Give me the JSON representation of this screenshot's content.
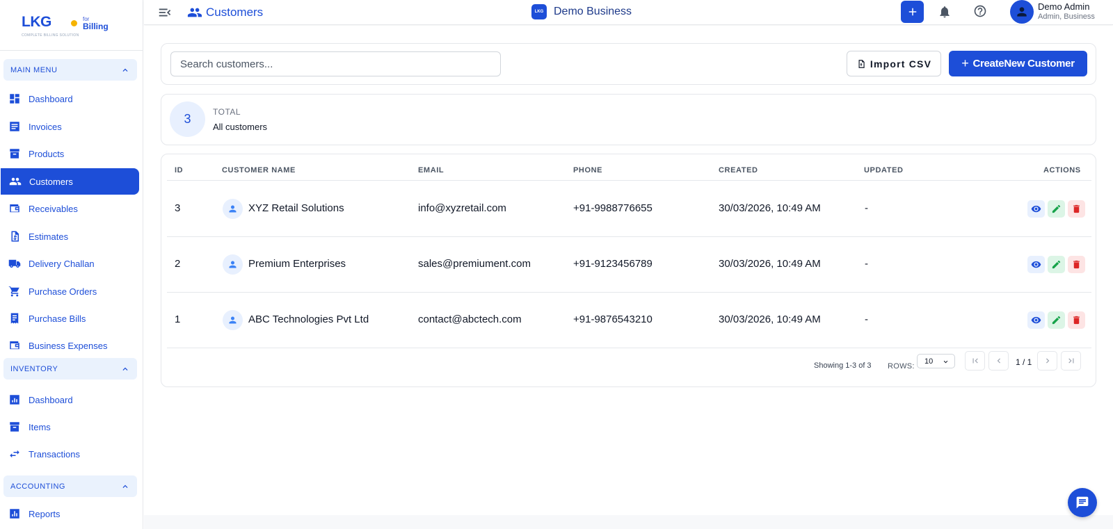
{
  "brand": {
    "logo_text": "LKG",
    "for_text": "for",
    "billing_text": "Billing",
    "tagline": "COMPLETE BILLING SOLUTION"
  },
  "sidebar": {
    "sections": [
      {
        "title": "MAIN MENU",
        "items": [
          {
            "label": "Dashboard",
            "icon": "dashboard-icon"
          },
          {
            "label": "Invoices",
            "icon": "invoice-icon"
          },
          {
            "label": "Products",
            "icon": "archive-icon"
          },
          {
            "label": "Customers",
            "icon": "people-icon",
            "active": true
          },
          {
            "label": "Receivables",
            "icon": "wallet-icon"
          },
          {
            "label": "Estimates",
            "icon": "estimate-icon"
          },
          {
            "label": "Delivery Challan",
            "icon": "truck-icon"
          },
          {
            "label": "Purchase Orders",
            "icon": "cart-icon"
          },
          {
            "label": "Purchase Bills",
            "icon": "bill-icon"
          },
          {
            "label": "Business Expenses",
            "icon": "wallet-icon"
          }
        ]
      },
      {
        "title": "INVENTORY",
        "items": [
          {
            "label": "Dashboard",
            "icon": "analytics-icon"
          },
          {
            "label": "Items",
            "icon": "archive-icon"
          },
          {
            "label": "Transactions",
            "icon": "swap-icon"
          }
        ]
      },
      {
        "title": "ACCOUNTING",
        "items": [
          {
            "label": "Reports",
            "icon": "bar-chart-icon"
          }
        ]
      }
    ]
  },
  "header": {
    "title": "Customers",
    "business_name": "Demo Business",
    "business_icon_text": "LKG",
    "user_name": "Demo Admin",
    "user_role": "Admin, Business"
  },
  "toolbar": {
    "search_placeholder": "Search customers...",
    "import_label": "Import CSV",
    "create_label": "CreateNew Customer",
    "create_plus": "+"
  },
  "stats": {
    "count": "3",
    "label": "TOTAL",
    "sublabel": "All customers"
  },
  "table": {
    "columns": [
      "ID",
      "CUSTOMER NAME",
      "EMAIL",
      "PHONE",
      "CREATED",
      "UPDATED",
      "ACTIONS"
    ],
    "rows": [
      {
        "id": "3",
        "name": "XYZ Retail Solutions",
        "email": "info@xyzretail.com",
        "phone": "+91-9988776655",
        "created": "30/03/2026, 10:49 AM",
        "updated": "-"
      },
      {
        "id": "2",
        "name": "Premium Enterprises",
        "email": "sales@premiument.com",
        "phone": "+91-9123456789",
        "created": "30/03/2026, 10:49 AM",
        "updated": "-"
      },
      {
        "id": "1",
        "name": "ABC Technologies Pvt Ltd",
        "email": "contact@abctech.com",
        "phone": "+91-9876543210",
        "created": "30/03/2026, 10:49 AM",
        "updated": "-"
      }
    ]
  },
  "pagination": {
    "showing": "Showing 1-3 of 3",
    "rows_label": "ROWS:",
    "rows_value": "10",
    "page": "1 / 1"
  },
  "colors": {
    "primary": "#1d4ed8",
    "view_bg": "#e8f0fe",
    "edit_bg": "#dcf5e6",
    "delete_bg": "#fde4e4",
    "delete": "#dc2626",
    "edit": "#16a34a"
  }
}
